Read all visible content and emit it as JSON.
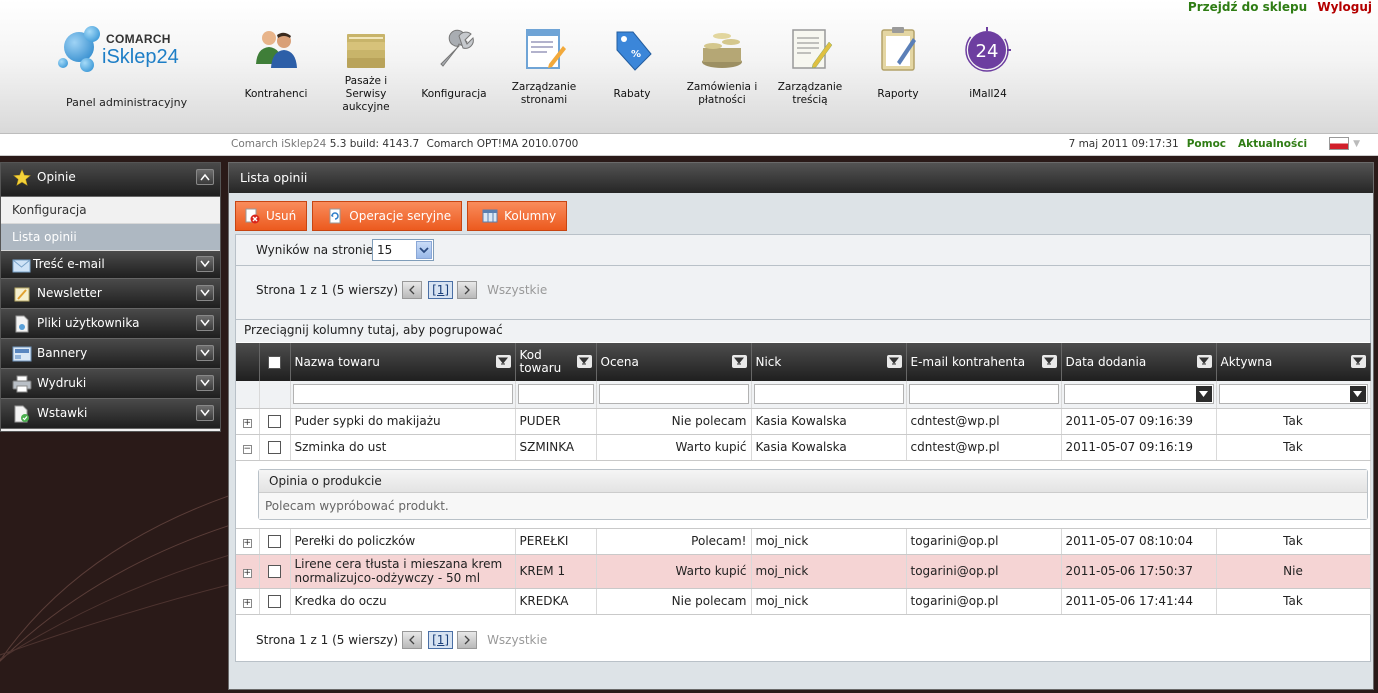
{
  "header": {
    "links": {
      "shop": "Przejdź do sklepu",
      "logout": "Wyloguj"
    },
    "logo": {
      "brand_top": "COMARCH",
      "brand_main": "iSklep24"
    },
    "panel_label": "Panel administracyjny",
    "nav": [
      {
        "label": "Kontrahenci",
        "icon": "users-icon"
      },
      {
        "label": "Pasaże i Serwisy aukcyjne",
        "icon": "folders-icon"
      },
      {
        "label": "Konfiguracja",
        "icon": "wrench-icon"
      },
      {
        "label": "Zarządzanie stronami",
        "icon": "page-edit-icon"
      },
      {
        "label": "Rabaty",
        "icon": "discount-tag-icon"
      },
      {
        "label": "Zamówienia i płatności",
        "icon": "coins-basket-icon"
      },
      {
        "label": "Zarządzanie treścią",
        "icon": "document-edit-icon"
      },
      {
        "label": "Raporty",
        "icon": "clipboard-icon"
      },
      {
        "label": "iMall24",
        "icon": "imall24-icon",
        "badge": "24"
      }
    ]
  },
  "status": {
    "product": "Comarch iSklep24",
    "version": "5.3 build: 4143.7",
    "optima": "Comarch OPT!MA 2010.0700",
    "datetime": "7 maj 2011 09:17:31",
    "help": "Pomoc",
    "news": "Aktualności"
  },
  "sidebar": {
    "sections": [
      {
        "label": "Opinie",
        "icon": "star-icon",
        "open": true,
        "links": [
          "Konfiguracja",
          "Lista opinii"
        ],
        "active_link": "Lista opinii"
      },
      {
        "label": "Treść e-mail",
        "icon": "envelope-icon"
      },
      {
        "label": "Newsletter",
        "icon": "newsletter-icon"
      },
      {
        "label": "Pliki użytkownika",
        "icon": "file-icon"
      },
      {
        "label": "Bannery",
        "icon": "banner-icon"
      },
      {
        "label": "Wydruki",
        "icon": "printer-icon"
      },
      {
        "label": "Wstawki",
        "icon": "insert-icon"
      }
    ]
  },
  "main": {
    "title": "Lista opinii",
    "toolbar": {
      "delete": "Usuń",
      "batch": "Operacje seryjne",
      "columns": "Kolumny"
    },
    "per_page_label": "Wyników na stronie:",
    "per_page_value": "15",
    "pager": {
      "info": "Strona 1 z 1 (5 wierszy)",
      "current": "[1]",
      "all": "Wszystkie"
    },
    "group_hint": "Przeciągnij kolumny tutaj, aby pogrupować",
    "columns": [
      "Nazwa towaru",
      "Kod towaru",
      "Ocena",
      "Nick",
      "E-mail kontrahenta",
      "Data dodania",
      "Aktywna"
    ],
    "rows": [
      {
        "expanded": false,
        "highlight": false,
        "name": "Puder sypki do makijażu",
        "code": "PUDER",
        "rating": "Nie polecam",
        "nick": "Kasia Kowalska",
        "email": "cdntest@wp.pl",
        "date": "2011-05-07 09:16:39",
        "active": "Tak"
      },
      {
        "expanded": true,
        "highlight": false,
        "name": "Szminka do ust",
        "code": "SZMINKA",
        "rating": "Warto kupić",
        "nick": "Kasia Kowalska",
        "email": "cdntest@wp.pl",
        "date": "2011-05-07 09:16:19",
        "active": "Tak"
      },
      {
        "expanded": false,
        "highlight": false,
        "name": "Perełki do policzków",
        "code": "PEREŁKI",
        "rating": "Polecam!",
        "nick": "moj_nick",
        "email": "togarini@op.pl",
        "date": "2011-05-07 08:10:04",
        "active": "Tak"
      },
      {
        "expanded": false,
        "highlight": true,
        "name": "Lirene cera tłusta i mieszana krem normalizujco-odżywczy - 50 ml",
        "code": "KREM 1",
        "rating": "Warto kupić",
        "nick": "moj_nick",
        "email": "togarini@op.pl",
        "date": "2011-05-06 17:50:37",
        "active": "Nie"
      },
      {
        "expanded": false,
        "highlight": false,
        "name": "Kredka do oczu",
        "code": "KREDKA",
        "rating": "Nie polecam",
        "nick": "moj_nick",
        "email": "togarini@op.pl",
        "date": "2011-05-06 17:41:44",
        "active": "Tak"
      }
    ],
    "detail": {
      "title": "Opinia o produkcie",
      "text": "Polecam wypróbować produkt."
    }
  },
  "colors": {
    "accent_orange": "#ec5a1e",
    "link_green": "#2f7d14",
    "logout_red": "#b40000",
    "highlight_row": "#f5d4d4"
  }
}
